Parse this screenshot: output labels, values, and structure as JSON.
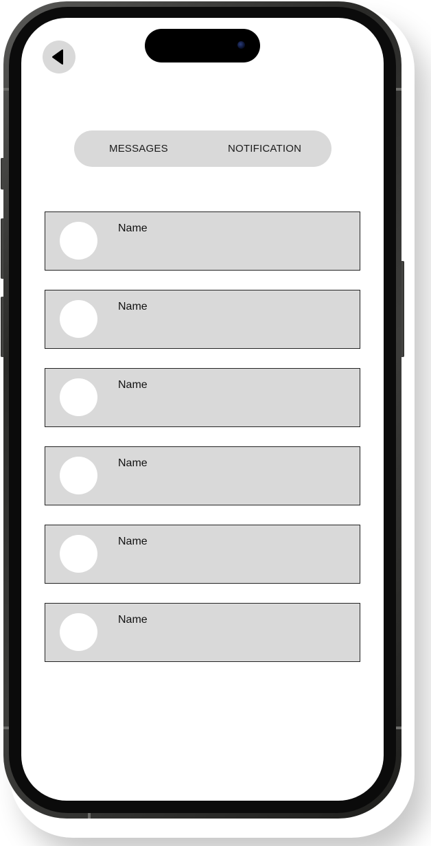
{
  "header": {
    "back_icon": "back-arrow-icon"
  },
  "tabs": [
    {
      "label": "MESSAGES"
    },
    {
      "label": "NOTIFICATION"
    }
  ],
  "list": {
    "items": [
      {
        "name": "Name"
      },
      {
        "name": "Name"
      },
      {
        "name": "Name"
      },
      {
        "name": "Name"
      },
      {
        "name": "Name"
      },
      {
        "name": "Name"
      }
    ]
  },
  "colors": {
    "surface_gray": "#d9d9d9",
    "background": "#ffffff",
    "text": "#111111"
  }
}
